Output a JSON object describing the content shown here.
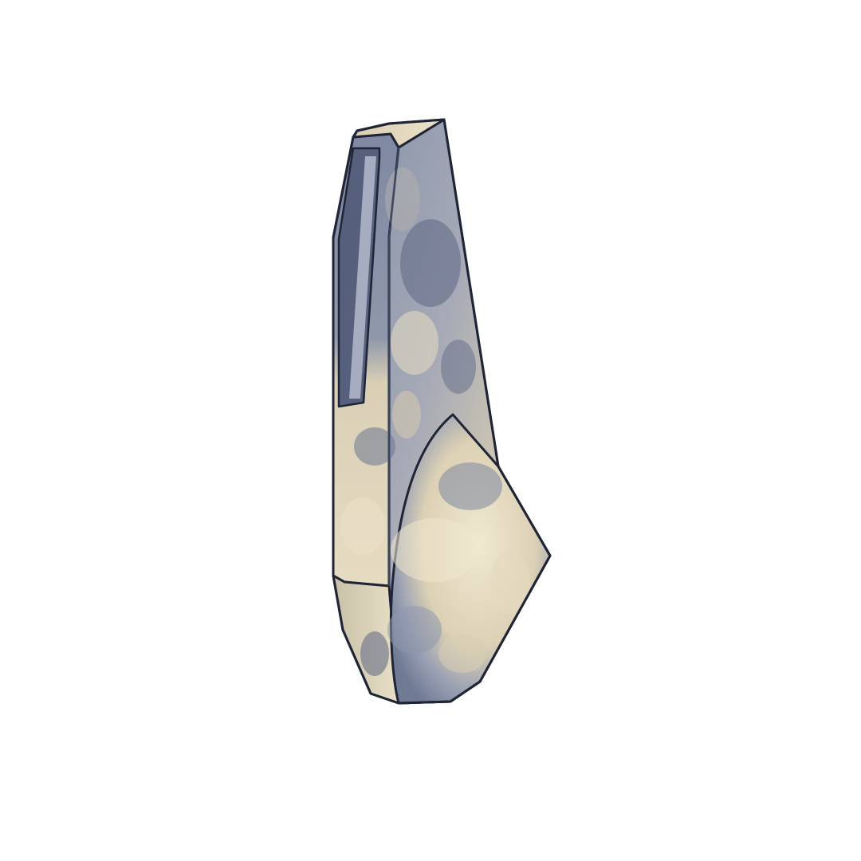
{
  "scene": {
    "background": "#ffffff",
    "object": {
      "kind": "low-poly 3D model",
      "palette": {
        "cream": "#e3d7b8",
        "cream_light": "#efe6cf",
        "slate": "#7c869c",
        "slate_dark": "#4e5a74",
        "outline": "#1f2536",
        "groove": "#5d6784"
      }
    }
  }
}
